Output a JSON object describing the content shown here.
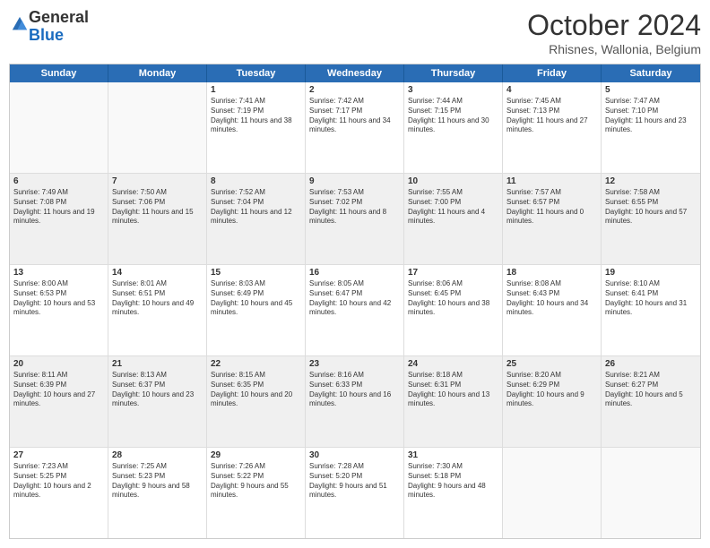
{
  "header": {
    "logo_general": "General",
    "logo_blue": "Blue",
    "month_title": "October 2024",
    "subtitle": "Rhisnes, Wallonia, Belgium"
  },
  "weekdays": [
    "Sunday",
    "Monday",
    "Tuesday",
    "Wednesday",
    "Thursday",
    "Friday",
    "Saturday"
  ],
  "rows": [
    [
      {
        "day": "",
        "info": "",
        "empty": true
      },
      {
        "day": "",
        "info": "",
        "empty": true
      },
      {
        "day": "1",
        "info": "Sunrise: 7:41 AM\nSunset: 7:19 PM\nDaylight: 11 hours and 38 minutes."
      },
      {
        "day": "2",
        "info": "Sunrise: 7:42 AM\nSunset: 7:17 PM\nDaylight: 11 hours and 34 minutes."
      },
      {
        "day": "3",
        "info": "Sunrise: 7:44 AM\nSunset: 7:15 PM\nDaylight: 11 hours and 30 minutes."
      },
      {
        "day": "4",
        "info": "Sunrise: 7:45 AM\nSunset: 7:13 PM\nDaylight: 11 hours and 27 minutes."
      },
      {
        "day": "5",
        "info": "Sunrise: 7:47 AM\nSunset: 7:10 PM\nDaylight: 11 hours and 23 minutes."
      }
    ],
    [
      {
        "day": "6",
        "info": "Sunrise: 7:49 AM\nSunset: 7:08 PM\nDaylight: 11 hours and 19 minutes.",
        "shaded": true
      },
      {
        "day": "7",
        "info": "Sunrise: 7:50 AM\nSunset: 7:06 PM\nDaylight: 11 hours and 15 minutes.",
        "shaded": true
      },
      {
        "day": "8",
        "info": "Sunrise: 7:52 AM\nSunset: 7:04 PM\nDaylight: 11 hours and 12 minutes.",
        "shaded": true
      },
      {
        "day": "9",
        "info": "Sunrise: 7:53 AM\nSunset: 7:02 PM\nDaylight: 11 hours and 8 minutes.",
        "shaded": true
      },
      {
        "day": "10",
        "info": "Sunrise: 7:55 AM\nSunset: 7:00 PM\nDaylight: 11 hours and 4 minutes.",
        "shaded": true
      },
      {
        "day": "11",
        "info": "Sunrise: 7:57 AM\nSunset: 6:57 PM\nDaylight: 11 hours and 0 minutes.",
        "shaded": true
      },
      {
        "day": "12",
        "info": "Sunrise: 7:58 AM\nSunset: 6:55 PM\nDaylight: 10 hours and 57 minutes.",
        "shaded": true
      }
    ],
    [
      {
        "day": "13",
        "info": "Sunrise: 8:00 AM\nSunset: 6:53 PM\nDaylight: 10 hours and 53 minutes."
      },
      {
        "day": "14",
        "info": "Sunrise: 8:01 AM\nSunset: 6:51 PM\nDaylight: 10 hours and 49 minutes."
      },
      {
        "day": "15",
        "info": "Sunrise: 8:03 AM\nSunset: 6:49 PM\nDaylight: 10 hours and 45 minutes."
      },
      {
        "day": "16",
        "info": "Sunrise: 8:05 AM\nSunset: 6:47 PM\nDaylight: 10 hours and 42 minutes."
      },
      {
        "day": "17",
        "info": "Sunrise: 8:06 AM\nSunset: 6:45 PM\nDaylight: 10 hours and 38 minutes."
      },
      {
        "day": "18",
        "info": "Sunrise: 8:08 AM\nSunset: 6:43 PM\nDaylight: 10 hours and 34 minutes."
      },
      {
        "day": "19",
        "info": "Sunrise: 8:10 AM\nSunset: 6:41 PM\nDaylight: 10 hours and 31 minutes."
      }
    ],
    [
      {
        "day": "20",
        "info": "Sunrise: 8:11 AM\nSunset: 6:39 PM\nDaylight: 10 hours and 27 minutes.",
        "shaded": true
      },
      {
        "day": "21",
        "info": "Sunrise: 8:13 AM\nSunset: 6:37 PM\nDaylight: 10 hours and 23 minutes.",
        "shaded": true
      },
      {
        "day": "22",
        "info": "Sunrise: 8:15 AM\nSunset: 6:35 PM\nDaylight: 10 hours and 20 minutes.",
        "shaded": true
      },
      {
        "day": "23",
        "info": "Sunrise: 8:16 AM\nSunset: 6:33 PM\nDaylight: 10 hours and 16 minutes.",
        "shaded": true
      },
      {
        "day": "24",
        "info": "Sunrise: 8:18 AM\nSunset: 6:31 PM\nDaylight: 10 hours and 13 minutes.",
        "shaded": true
      },
      {
        "day": "25",
        "info": "Sunrise: 8:20 AM\nSunset: 6:29 PM\nDaylight: 10 hours and 9 minutes.",
        "shaded": true
      },
      {
        "day": "26",
        "info": "Sunrise: 8:21 AM\nSunset: 6:27 PM\nDaylight: 10 hours and 5 minutes.",
        "shaded": true
      }
    ],
    [
      {
        "day": "27",
        "info": "Sunrise: 7:23 AM\nSunset: 5:25 PM\nDaylight: 10 hours and 2 minutes."
      },
      {
        "day": "28",
        "info": "Sunrise: 7:25 AM\nSunset: 5:23 PM\nDaylight: 9 hours and 58 minutes."
      },
      {
        "day": "29",
        "info": "Sunrise: 7:26 AM\nSunset: 5:22 PM\nDaylight: 9 hours and 55 minutes."
      },
      {
        "day": "30",
        "info": "Sunrise: 7:28 AM\nSunset: 5:20 PM\nDaylight: 9 hours and 51 minutes."
      },
      {
        "day": "31",
        "info": "Sunrise: 7:30 AM\nSunset: 5:18 PM\nDaylight: 9 hours and 48 minutes."
      },
      {
        "day": "",
        "info": "",
        "empty": true
      },
      {
        "day": "",
        "info": "",
        "empty": true
      }
    ]
  ]
}
